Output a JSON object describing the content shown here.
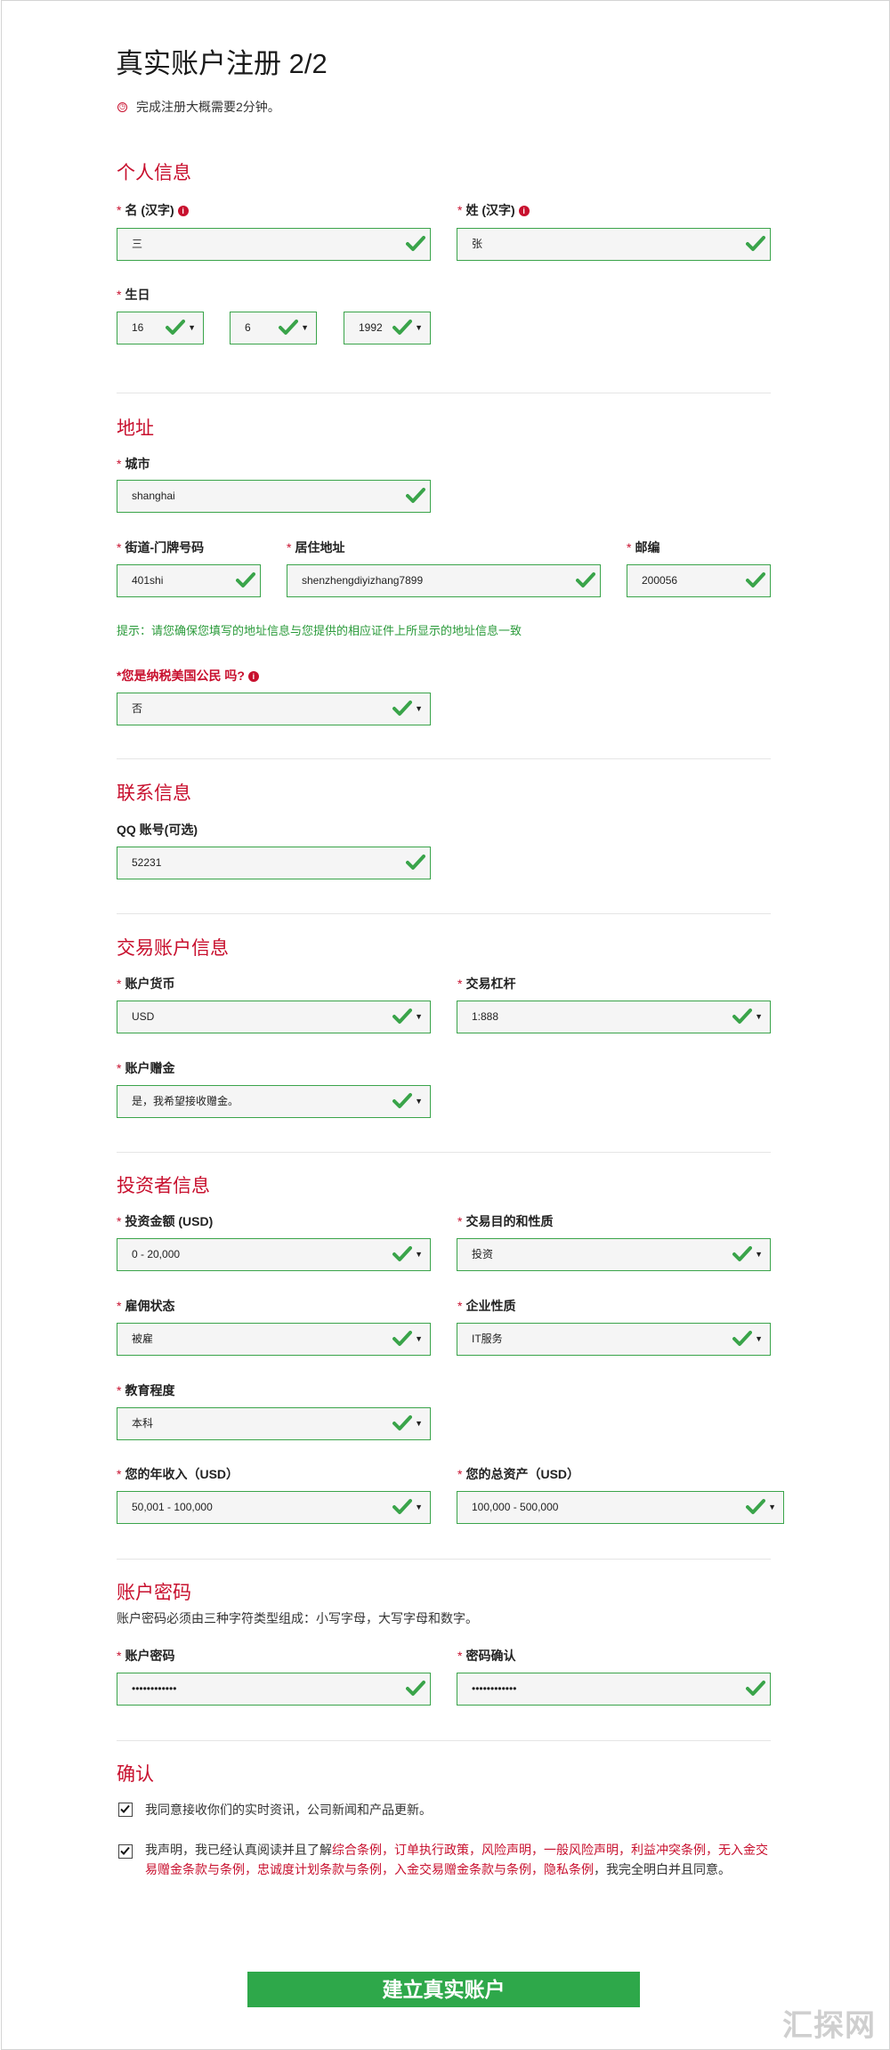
{
  "page": {
    "title": "真实账户注册 2/2",
    "note": "完成注册大概需要2分钟。",
    "note_icon": "clock-icon"
  },
  "colors": {
    "accent": "#c8102e",
    "valid": "#3aa44a",
    "submit": "#2ea84a",
    "hint": "#2a9a3a"
  },
  "personal": {
    "heading": "个人信息",
    "first_name_label": "名 (汉字)",
    "first_name_value": "三",
    "last_name_label": "姓 (汉字)",
    "last_name_value": "张",
    "birthday_label": "生日",
    "day": "16",
    "month": "6",
    "year": "1992"
  },
  "address": {
    "heading": "地址",
    "city_label": "城市",
    "city_value": "shanghai",
    "street_label": "街道-门牌号码",
    "street_value": "401shi",
    "residence_label": "居住地址",
    "residence_value": "shenzhengdiyizhang7899",
    "zip_label": "邮编",
    "zip_value": "200056",
    "hint": "提示：请您确保您填写的地址信息与您提供的相应证件上所显示的地址信息一致",
    "us_tax_label": "*您是纳税美国公民 吗?",
    "us_tax_value": "否"
  },
  "contact": {
    "heading": "联系信息",
    "qq_label": "QQ 账号(可选)",
    "qq_value": "52231"
  },
  "trading": {
    "heading": "交易账户信息",
    "currency_label": "账户货币",
    "currency_value": "USD",
    "leverage_label": "交易杠杆",
    "leverage_value": "1:888",
    "bonus_label": "账户赠金",
    "bonus_value": "是，我希望接收赠金。"
  },
  "investor": {
    "heading": "投资者信息",
    "amount_label": "投资金额 (USD)",
    "amount_value": "0 - 20,000",
    "purpose_label": "交易目的和性质",
    "purpose_value": "投资",
    "employment_label": "雇佣状态",
    "employment_value": "被雇",
    "industry_label": "企业性质",
    "industry_value": "IT服务",
    "education_label": "教育程度",
    "education_value": "本科",
    "income_label": "您的年收入（USD）",
    "income_value": "50,001 - 100,000",
    "assets_label": "您的总资产（USD）",
    "assets_value": "100,000 - 500,000"
  },
  "password": {
    "heading": "账户密码",
    "note": "账户密码必须由三种字符类型组成：小写字母，大写字母和数字。",
    "password_label": "账户密码",
    "password_value": "••••••••••••",
    "confirm_label": "密码确认",
    "confirm_value": "••••••••••••"
  },
  "confirm": {
    "heading": "确认",
    "agree_news": "我同意接收你们的实时资讯，公司新闻和产品更新。",
    "decl_1": "我声明，我已经认真阅读并且了解",
    "link_1": "综合条例",
    "sep_1": "，",
    "link_2": "订单执行政策",
    "sep_2": "，",
    "link_3": "风险声明",
    "sep_3": "，",
    "link_4": "一般风险声明",
    "sep_4": "，",
    "link_5": "利益冲突条例",
    "sep_5": "，",
    "link_6": "无入金交易赠金条款与条例",
    "sep_6": "，",
    "link_7": "忠诚度计划条款与条例",
    "sep_7": "，",
    "link_8": "入金交易赠金条款与条例",
    "sep_8": "，",
    "link_9": "隐私条例",
    "decl_end": "，我完全明白并且同意。"
  },
  "submit_label": "建立真实账户",
  "watermark": "汇探网",
  "dropdown_arrow": "▼"
}
